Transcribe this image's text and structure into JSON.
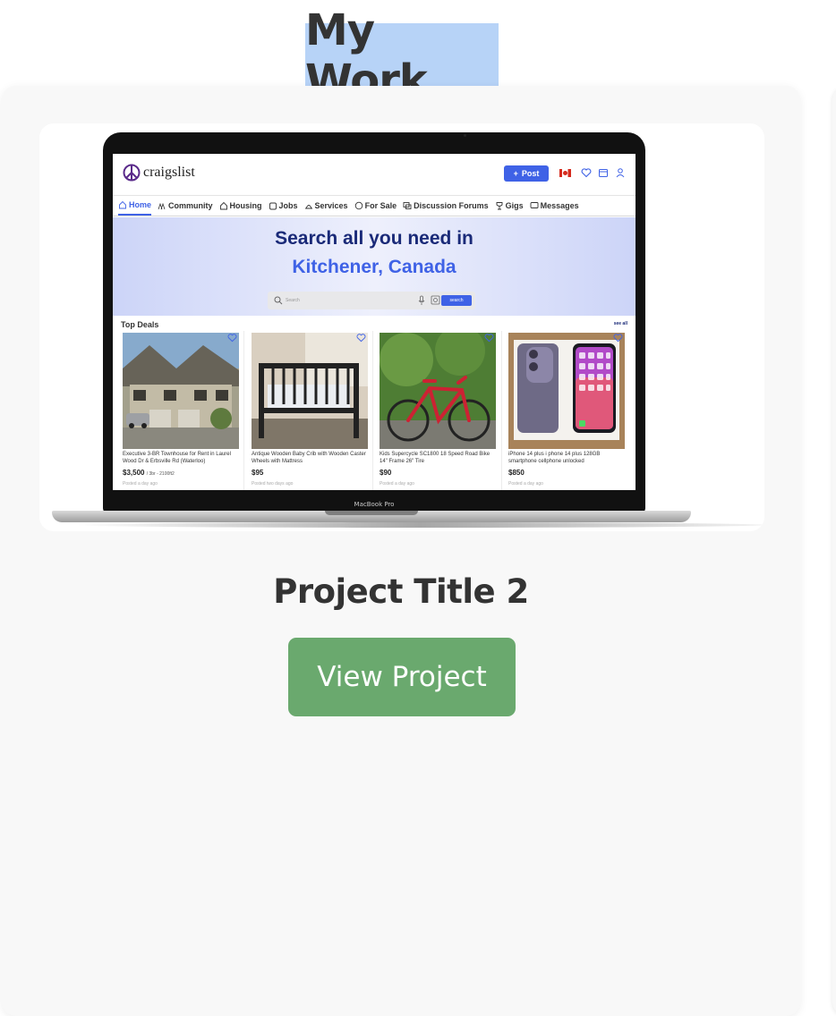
{
  "section": {
    "title": "My Work"
  },
  "project": {
    "title": "Project Title 2",
    "button_label": "View Project"
  },
  "preview": {
    "device_label": "MacBook Pro",
    "site": {
      "logo_text": "craigslist",
      "post_label": "Post",
      "nav": [
        {
          "label": "Home",
          "icon": "home-icon"
        },
        {
          "label": "Community",
          "icon": "community-icon"
        },
        {
          "label": "Housing",
          "icon": "housing-icon"
        },
        {
          "label": "Jobs",
          "icon": "jobs-icon"
        },
        {
          "label": "Services",
          "icon": "services-icon"
        },
        {
          "label": "For Sale",
          "icon": "for-sale-icon"
        },
        {
          "label": "Discussion Forums",
          "icon": "forums-icon"
        },
        {
          "label": "Gigs",
          "icon": "gigs-icon"
        },
        {
          "label": "Messages",
          "icon": "messages-icon"
        }
      ],
      "hero_line1": "Search  all you need in",
      "hero_line2": "Kitchener, Canada",
      "search_placeholder": "Search",
      "search_button": "search",
      "deals_title": "Top Deals",
      "see_all": "see all",
      "deals": [
        {
          "title": "Executive 3-BR Townhouse for Rent in Laurel Wood Dr & Erbsville Rd (Waterloo)",
          "price": "$3,500",
          "price_sub": "/ 3br - 2100ft2",
          "posted": "Posted a day ago"
        },
        {
          "title": "Antique Wooden Baby Crib with Wooden Caster Wheels with Mattress",
          "price": "$95",
          "price_sub": "",
          "posted": "Posted two days ago"
        },
        {
          "title": "Kids Supercycle SC1800 18 Speed Road Bike 14\" Frame 26\" Tire",
          "price": "$90",
          "price_sub": "",
          "posted": "Posted a day ago"
        },
        {
          "title": "iPhone 14 plus i phone 14 plus 128GB smartphone cellphone unlocked",
          "price": "$850",
          "price_sub": "",
          "posted": "Posted a day ago"
        }
      ]
    }
  },
  "colors": {
    "title_highlight": "#b7d3f7",
    "button_bg": "#6aa96e",
    "accent": "#3f62e6"
  }
}
